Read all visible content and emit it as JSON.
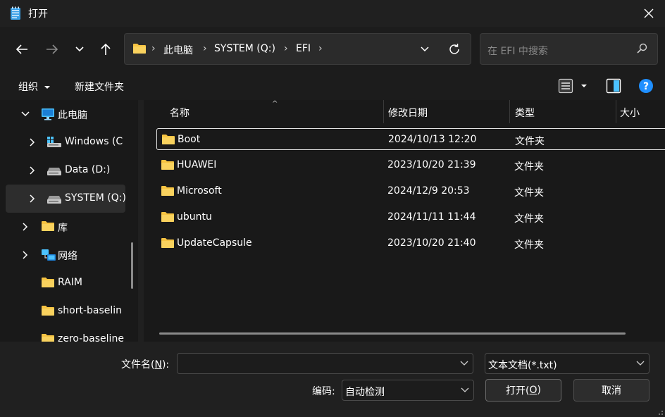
{
  "window": {
    "title": "打开"
  },
  "address": {
    "crumbs": [
      "此电脑",
      "SYSTEM (Q:)",
      "EFI"
    ],
    "separator": "›"
  },
  "search": {
    "placeholder": "在 EFI 中搜索"
  },
  "toolbar": {
    "organize": "组织",
    "new_folder": "新建文件夹"
  },
  "sidebar": {
    "items": [
      {
        "label": "此电脑",
        "icon": "monitor-icon",
        "expanded": true
      },
      {
        "label": "Windows (C",
        "icon": "windows-drive-icon"
      },
      {
        "label": "Data (D:)",
        "icon": "drive-icon"
      },
      {
        "label": "SYSTEM (Q:)",
        "icon": "drive-icon",
        "selected": true
      },
      {
        "label": "库",
        "icon": "folder-icon"
      },
      {
        "label": "网络",
        "icon": "network-icon"
      },
      {
        "label": "RAIM",
        "icon": "folder-icon"
      },
      {
        "label": "short-baselin",
        "icon": "folder-icon"
      },
      {
        "label": "zero-baseline",
        "icon": "folder-icon"
      }
    ]
  },
  "columns": {
    "name": "名称",
    "modified": "修改日期",
    "type": "类型",
    "size": "大小"
  },
  "files": [
    {
      "name": "Boot",
      "modified": "2024/10/13 12:20",
      "type": "文件夹"
    },
    {
      "name": "HUAWEI",
      "modified": "2023/10/20 21:39",
      "type": "文件夹"
    },
    {
      "name": "Microsoft",
      "modified": "2024/12/9 20:53",
      "type": "文件夹"
    },
    {
      "name": "ubuntu",
      "modified": "2024/11/11 11:44",
      "type": "文件夹"
    },
    {
      "name": "UpdateCapsule",
      "modified": "2023/10/20 21:40",
      "type": "文件夹"
    }
  ],
  "bottom": {
    "filename_label_pre": "文件名(",
    "filename_label_key": "N",
    "filename_label_post": "):",
    "filename_value": "",
    "filetype_value": "文本文档(*.txt)",
    "encoding_label": "编码:",
    "encoding_value": "自动检测",
    "open_pre": "打开(",
    "open_key": "O",
    "open_post": ")",
    "cancel": "取消"
  },
  "colors": {
    "folder": "#f6c342",
    "accent": "#4cc2ff",
    "help": "#1f8fff"
  }
}
